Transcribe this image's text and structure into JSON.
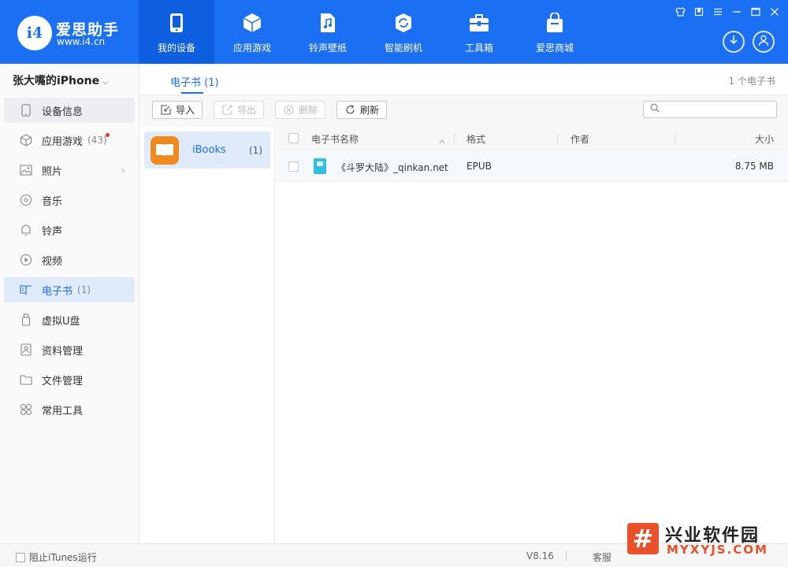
{
  "app": {
    "brand_name": "爱思助手",
    "brand_url": "www.i4.cn",
    "logo_text": "i4"
  },
  "nav": [
    {
      "label": "我的设备",
      "icon": "phone-icon"
    },
    {
      "label": "应用游戏",
      "icon": "cube-icon"
    },
    {
      "label": "铃声壁纸",
      "icon": "music-file-icon"
    },
    {
      "label": "智能刷机",
      "icon": "refresh-shield-icon"
    },
    {
      "label": "工具箱",
      "icon": "toolbox-icon"
    },
    {
      "label": "爱思商城",
      "icon": "shopping-bag-icon"
    }
  ],
  "device": {
    "name": "张大嘴的iPhone"
  },
  "sidebar": [
    {
      "label": "设备信息",
      "icon": "phone-outline-icon",
      "count": ""
    },
    {
      "label": "应用游戏",
      "icon": "cube-outline-icon",
      "count": "(43)"
    },
    {
      "label": "照片",
      "icon": "image-icon",
      "count": ""
    },
    {
      "label": "音乐",
      "icon": "music-disc-icon",
      "count": ""
    },
    {
      "label": "铃声",
      "icon": "bell-icon",
      "count": ""
    },
    {
      "label": "视频",
      "icon": "play-circle-icon",
      "count": ""
    },
    {
      "label": "电子书",
      "icon": "book-open-icon",
      "count": "(1)"
    },
    {
      "label": "虚拟U盘",
      "icon": "usb-icon",
      "count": ""
    },
    {
      "label": "资料管理",
      "icon": "contacts-icon",
      "count": ""
    },
    {
      "label": "文件管理",
      "icon": "folder-icon",
      "count": ""
    },
    {
      "label": "常用工具",
      "icon": "grid-icon",
      "count": ""
    }
  ],
  "tabs": {
    "ebook_tab": "电子书 (1)",
    "count_label": "1 个电子书"
  },
  "toolbar": {
    "import": "导入",
    "export": "导出",
    "delete": "删除",
    "refresh": "刷新",
    "search_placeholder": ""
  },
  "category": {
    "label": "iBooks",
    "count": "(1)"
  },
  "table": {
    "headers": {
      "name": "电子书名称",
      "format": "格式",
      "author": "作者",
      "size": "大小"
    },
    "rows": [
      {
        "name": "《斗罗大陆》_qinkan.net",
        "format": "EPUB",
        "author": "",
        "size": "8.75 MB"
      }
    ]
  },
  "status": {
    "itunes": "阻止iTunes运行",
    "version": "V8.16",
    "service": "客服"
  },
  "watermark": {
    "cn": "兴业软件园",
    "en": "MYXYJS.COM",
    "icon": "#"
  },
  "colors": {
    "primary": "#1a6ff2",
    "watermark": "#e9512a"
  }
}
